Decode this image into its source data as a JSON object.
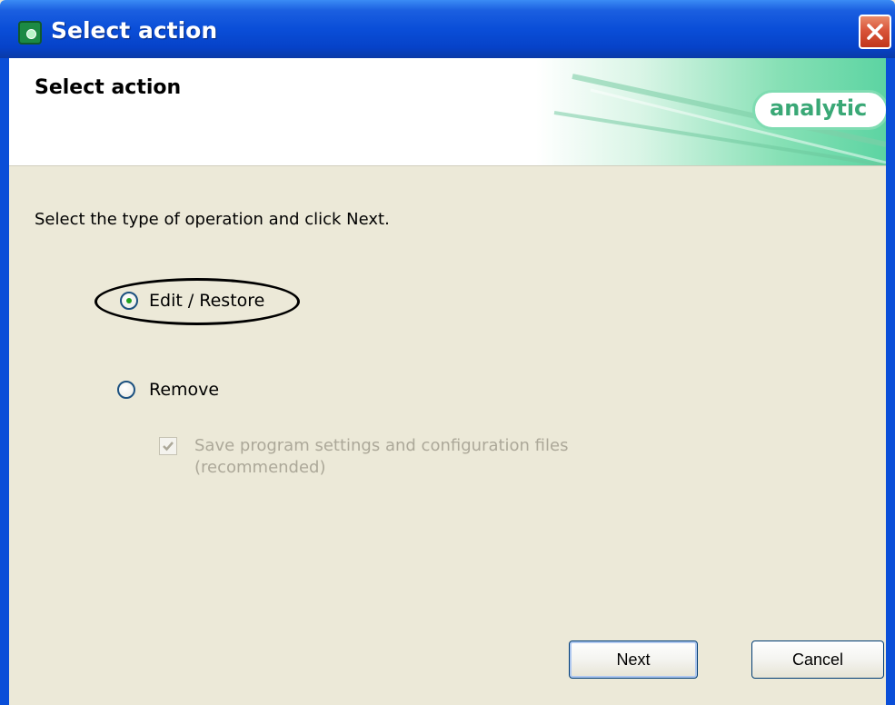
{
  "window": {
    "title": "Select action",
    "close_icon": "close-icon"
  },
  "header": {
    "title": "Select action",
    "brand": "analytic"
  },
  "content": {
    "instruction": "Select the type of operation and click Next.",
    "options": [
      {
        "label": "Edit / Restore",
        "selected": true
      },
      {
        "label": "Remove",
        "selected": false
      }
    ],
    "checkbox": {
      "line1": "Save program settings and configuration files",
      "line2": "(recommended)",
      "checked": true,
      "enabled": false
    }
  },
  "buttons": {
    "next": "Next",
    "cancel": "Cancel"
  },
  "colors": {
    "titlebar": "#0a4ed8",
    "dialog_bg": "#ece9d8",
    "brand_green": "#3aa876",
    "close_red": "#c1361b"
  }
}
